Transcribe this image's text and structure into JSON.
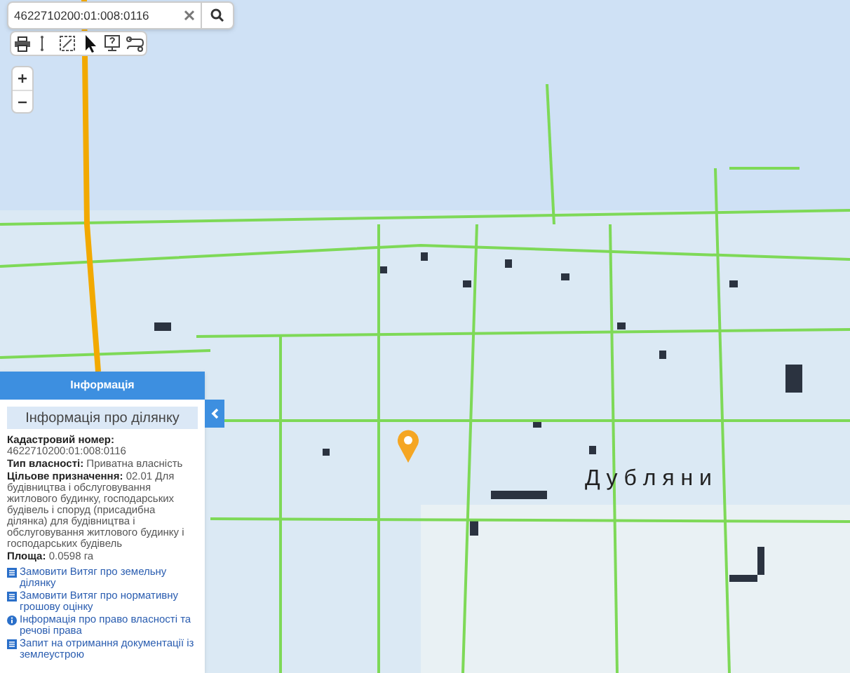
{
  "search": {
    "value": "4622710200:01:008:0116"
  },
  "map": {
    "label": "Д у б л я н и"
  },
  "info_panel": {
    "title": "Інформація",
    "parcel_button": "Інформація про ділянку",
    "fields": [
      {
        "kind": "stacked",
        "label": "Кадастровий номер:",
        "value": "4622710200:01:008:0116"
      },
      {
        "kind": "inline",
        "label": "Тип власності:",
        "value": "Приватна власність"
      },
      {
        "kind": "inline",
        "label": "Цільове призначення:",
        "value": "02.01 Для будівництва і обслуговування житлового будинку, господарських будівель і споруд (присадибна ділянка) для будівництва і обслуговування житлового будинку і господарських будівель"
      },
      {
        "kind": "inline",
        "label": "Площа:",
        "value": "0.0598 га"
      }
    ],
    "links": [
      {
        "kind": "document",
        "text": "Замовити Витяг про земельну ділянку"
      },
      {
        "kind": "document",
        "text": "Замовити Витяг про нормативну грошову оцінку"
      },
      {
        "kind": "info",
        "text": "Інформація про право власності та речові права"
      },
      {
        "kind": "document",
        "text": "Запит на отримання документації із землеустрою"
      }
    ]
  }
}
